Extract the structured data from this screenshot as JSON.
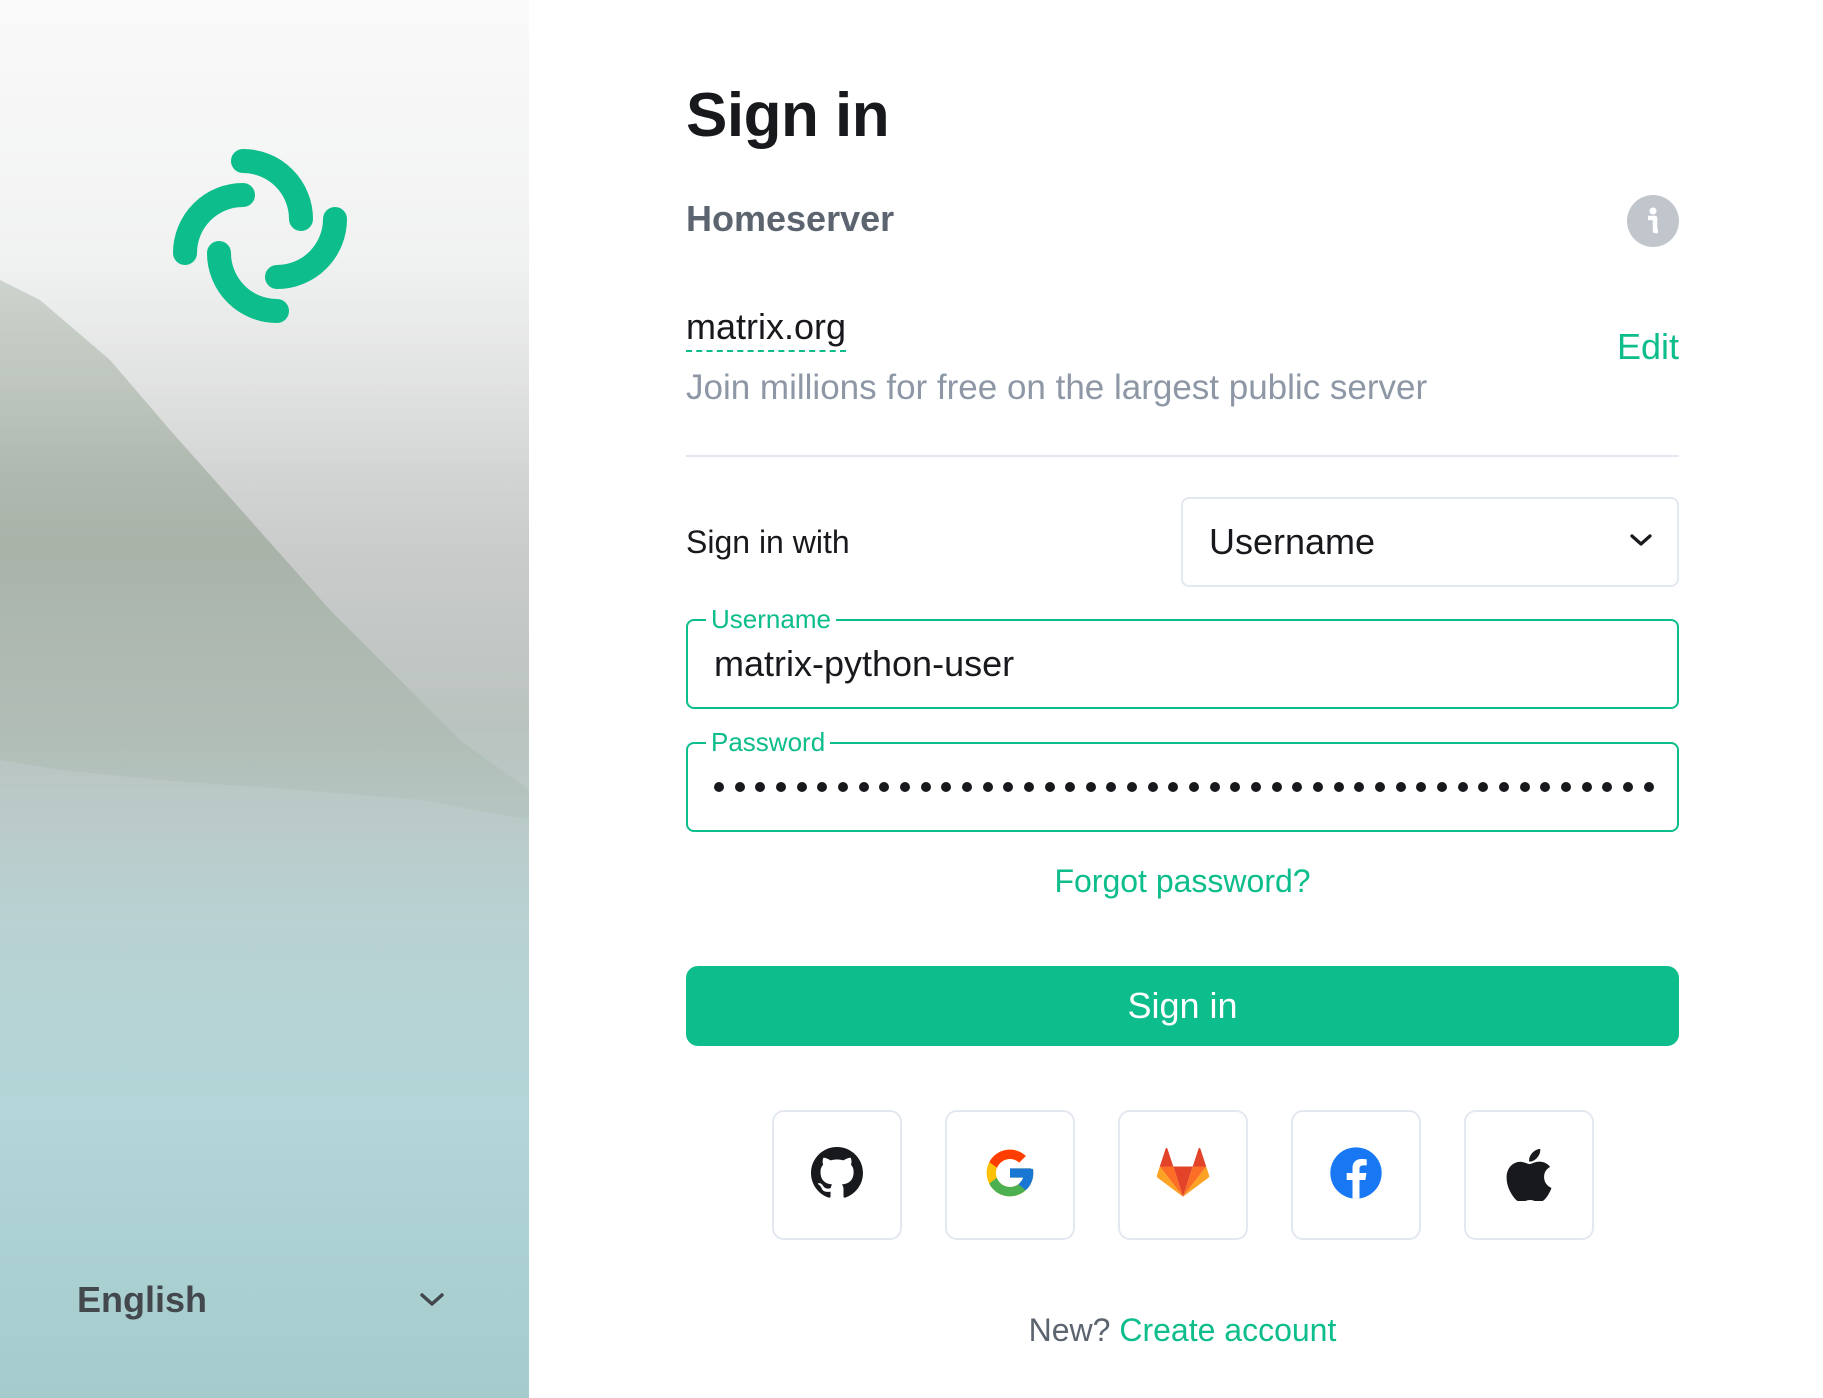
{
  "brand": {
    "accent_color": "#0dbd8b",
    "logo_icon": "element-logo-icon"
  },
  "language": {
    "selected": "English",
    "icon": "chevron-down-icon"
  },
  "header": {
    "title": "Sign in"
  },
  "homeserver": {
    "heading": "Homeserver",
    "info_icon": "info-icon",
    "name": "matrix.org",
    "description": "Join millions for free on the largest public server",
    "edit_label": "Edit"
  },
  "sign_in_with": {
    "label": "Sign in with",
    "selected": "Username",
    "icon": "chevron-down-icon"
  },
  "username_field": {
    "label": "Username",
    "value": "matrix-python-user"
  },
  "password_field": {
    "label": "Password",
    "masked_length": 46
  },
  "forgot_password": "Forgot password?",
  "submit_label": "Sign in",
  "sso_providers": [
    {
      "name": "GitHub",
      "icon": "github-icon"
    },
    {
      "name": "Google",
      "icon": "google-icon"
    },
    {
      "name": "GitLab",
      "icon": "gitlab-icon"
    },
    {
      "name": "Facebook",
      "icon": "facebook-icon"
    },
    {
      "name": "Apple",
      "icon": "apple-icon"
    }
  ],
  "footer": {
    "prompt": "New?",
    "create_account": "Create account"
  }
}
